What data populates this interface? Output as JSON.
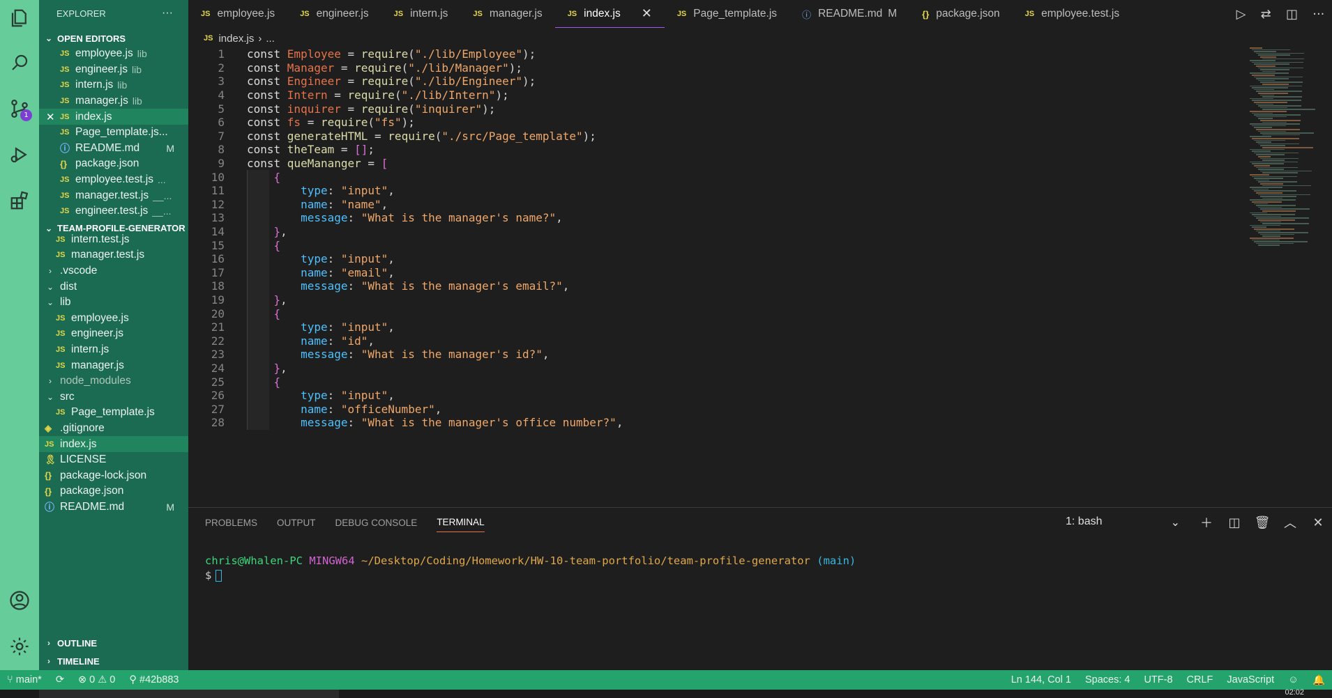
{
  "explorer": {
    "title": "EXPLORER",
    "more": "···",
    "open_editors_label": "OPEN EDITORS",
    "open_editors": [
      {
        "icon": "JS",
        "name": "employee.js",
        "desc": "lib",
        "mark": "",
        "close": ""
      },
      {
        "icon": "JS",
        "name": "engineer.js",
        "desc": "lib",
        "mark": "",
        "close": ""
      },
      {
        "icon": "JS",
        "name": "intern.js",
        "desc": "lib",
        "mark": "",
        "close": ""
      },
      {
        "icon": "JS",
        "name": "manager.js",
        "desc": "lib",
        "mark": "",
        "close": ""
      },
      {
        "icon": "JS",
        "name": "index.js",
        "desc": "",
        "mark": "",
        "close": "✕"
      },
      {
        "icon": "JS",
        "name": "Page_template.js...",
        "desc": "",
        "mark": "",
        "close": ""
      },
      {
        "icon": "ⓘ",
        "name": "README.md",
        "desc": "",
        "mark": "M",
        "close": ""
      },
      {
        "icon": "{}",
        "name": "package.json",
        "desc": "",
        "mark": "",
        "close": ""
      },
      {
        "icon": "JS",
        "name": "employee.test.js",
        "desc": "...",
        "mark": "",
        "close": ""
      },
      {
        "icon": "JS",
        "name": "manager.test.js",
        "desc": "__...",
        "mark": "",
        "close": ""
      },
      {
        "icon": "JS",
        "name": "engineer.test.js",
        "desc": "__...",
        "mark": "",
        "close": ""
      }
    ],
    "project_label": "TEAM-PROFILE-GENERATOR",
    "tree": [
      {
        "type": "file",
        "icon": "JS",
        "name": "intern.test.js",
        "indent": 1
      },
      {
        "type": "file",
        "icon": "JS",
        "name": "manager.test.js",
        "indent": 1
      },
      {
        "type": "folder",
        "twisty": "›",
        "name": ".vscode",
        "indent": 0
      },
      {
        "type": "folder",
        "twisty": "⌄",
        "name": "dist",
        "indent": 0
      },
      {
        "type": "folder",
        "twisty": "⌄",
        "name": "lib",
        "indent": 0
      },
      {
        "type": "file",
        "icon": "JS",
        "name": "employee.js",
        "indent": 1
      },
      {
        "type": "file",
        "icon": "JS",
        "name": "engineer.js",
        "indent": 1
      },
      {
        "type": "file",
        "icon": "JS",
        "name": "intern.js",
        "indent": 1
      },
      {
        "type": "file",
        "icon": "JS",
        "name": "manager.js",
        "indent": 1
      },
      {
        "type": "folder",
        "twisty": "›",
        "name": "node_modules",
        "indent": 0,
        "dim": true
      },
      {
        "type": "folder",
        "twisty": "⌄",
        "name": "src",
        "indent": 0
      },
      {
        "type": "file",
        "icon": "JS",
        "name": "Page_template.js",
        "indent": 1
      },
      {
        "type": "file",
        "icon": "◈",
        "name": ".gitignore",
        "indent": 0
      },
      {
        "type": "file",
        "icon": "JS",
        "name": "index.js",
        "indent": 0,
        "selected": true
      },
      {
        "type": "file",
        "icon": "🎗",
        "name": "LICENSE",
        "indent": 0
      },
      {
        "type": "file",
        "icon": "{}",
        "name": "package-lock.json",
        "indent": 0
      },
      {
        "type": "file",
        "icon": "{}",
        "name": "package.json",
        "indent": 0
      },
      {
        "type": "file",
        "icon": "ⓘ",
        "name": "README.md",
        "indent": 0,
        "mark": "M"
      }
    ],
    "outline_label": "OUTLINE",
    "timeline_label": "TIMELINE"
  },
  "activity": {
    "scm_badge": "1"
  },
  "tabs": [
    {
      "icon": "JS",
      "label": "employee.js",
      "active": false,
      "mod": ""
    },
    {
      "icon": "JS",
      "label": "engineer.js",
      "active": false,
      "mod": ""
    },
    {
      "icon": "JS",
      "label": "intern.js",
      "active": false,
      "mod": ""
    },
    {
      "icon": "JS",
      "label": "manager.js",
      "active": false,
      "mod": ""
    },
    {
      "icon": "JS",
      "label": "index.js",
      "active": true,
      "mod": ""
    },
    {
      "icon": "JS",
      "label": "Page_template.js",
      "active": false,
      "mod": ""
    },
    {
      "icon": "ⓘ",
      "label": "README.md",
      "active": false,
      "mod": "M"
    },
    {
      "icon": "{}",
      "label": "package.json",
      "active": false,
      "mod": ""
    },
    {
      "icon": "JS",
      "label": "employee.test.js",
      "active": false,
      "mod": ""
    }
  ],
  "breadcrumb": {
    "icon": "JS",
    "file": "index.js",
    "sep": "›",
    "rest": "..."
  },
  "code_lines": [
    [
      [
        "k",
        "const "
      ],
      [
        "v",
        "Employee"
      ],
      [
        "op",
        " = "
      ],
      [
        "f",
        "require"
      ],
      [
        "op",
        "("
      ],
      [
        "s",
        "\"./lib/Employee\""
      ],
      [
        "op",
        ");"
      ]
    ],
    [
      [
        "k",
        "const "
      ],
      [
        "v",
        "Manager"
      ],
      [
        "op",
        " = "
      ],
      [
        "f",
        "require"
      ],
      [
        "op",
        "("
      ],
      [
        "s",
        "\"./lib/Manager\""
      ],
      [
        "op",
        ");"
      ]
    ],
    [
      [
        "k",
        "const "
      ],
      [
        "v",
        "Engineer"
      ],
      [
        "op",
        " = "
      ],
      [
        "f",
        "require"
      ],
      [
        "op",
        "("
      ],
      [
        "s",
        "\"./lib/Engineer\""
      ],
      [
        "op",
        ");"
      ]
    ],
    [
      [
        "k",
        "const "
      ],
      [
        "v",
        "Intern"
      ],
      [
        "op",
        " = "
      ],
      [
        "f",
        "require"
      ],
      [
        "op",
        "("
      ],
      [
        "s",
        "\"./lib/Intern\""
      ],
      [
        "op",
        ");"
      ]
    ],
    [
      [
        "k",
        "const "
      ],
      [
        "v",
        "inquirer"
      ],
      [
        "op",
        " = "
      ],
      [
        "f",
        "require"
      ],
      [
        "op",
        "("
      ],
      [
        "s",
        "\"inquirer\""
      ],
      [
        "op",
        ");"
      ]
    ],
    [
      [
        "k",
        "const "
      ],
      [
        "v",
        "fs"
      ],
      [
        "op",
        " = "
      ],
      [
        "f",
        "require"
      ],
      [
        "op",
        "("
      ],
      [
        "s",
        "\"fs\""
      ],
      [
        "op",
        ");"
      ]
    ],
    [
      [
        "k",
        "const "
      ],
      [
        "f",
        "generateHTML"
      ],
      [
        "op",
        " = "
      ],
      [
        "f",
        "require"
      ],
      [
        "op",
        "("
      ],
      [
        "s",
        "\"./src/Page_template\""
      ],
      [
        "op",
        ");"
      ]
    ],
    [
      [
        "k",
        "const "
      ],
      [
        "f",
        "theTeam"
      ],
      [
        "op",
        " = "
      ],
      [
        "ob",
        "[]"
      ],
      [
        "op",
        ";"
      ]
    ],
    [
      [
        "k",
        "const "
      ],
      [
        "f",
        "queMananger"
      ],
      [
        "op",
        " = "
      ],
      [
        "ob",
        "["
      ]
    ],
    [
      [
        "op",
        "    "
      ],
      [
        "ob",
        "{"
      ]
    ],
    [
      [
        "op",
        "        "
      ],
      [
        "prop",
        "type"
      ],
      [
        "op",
        ": "
      ],
      [
        "s",
        "\"input\""
      ],
      [
        "op",
        ","
      ]
    ],
    [
      [
        "op",
        "        "
      ],
      [
        "prop",
        "name"
      ],
      [
        "op",
        ": "
      ],
      [
        "s",
        "\"name\""
      ],
      [
        "op",
        ","
      ]
    ],
    [
      [
        "op",
        "        "
      ],
      [
        "prop",
        "message"
      ],
      [
        "op",
        ": "
      ],
      [
        "s",
        "\"What is the manager's name?\""
      ],
      [
        "op",
        ","
      ]
    ],
    [
      [
        "op",
        "    "
      ],
      [
        "ob",
        "}"
      ],
      [
        "op",
        ","
      ]
    ],
    [
      [
        "op",
        "    "
      ],
      [
        "ob",
        "{"
      ]
    ],
    [
      [
        "op",
        "        "
      ],
      [
        "prop",
        "type"
      ],
      [
        "op",
        ": "
      ],
      [
        "s",
        "\"input\""
      ],
      [
        "op",
        ","
      ]
    ],
    [
      [
        "op",
        "        "
      ],
      [
        "prop",
        "name"
      ],
      [
        "op",
        ": "
      ],
      [
        "s",
        "\"email\""
      ],
      [
        "op",
        ","
      ]
    ],
    [
      [
        "op",
        "        "
      ],
      [
        "prop",
        "message"
      ],
      [
        "op",
        ": "
      ],
      [
        "s",
        "\"What is the manager's email?\""
      ],
      [
        "op",
        ","
      ]
    ],
    [
      [
        "op",
        "    "
      ],
      [
        "ob",
        "}"
      ],
      [
        "op",
        ","
      ]
    ],
    [
      [
        "op",
        "    "
      ],
      [
        "ob",
        "{"
      ]
    ],
    [
      [
        "op",
        "        "
      ],
      [
        "prop",
        "type"
      ],
      [
        "op",
        ": "
      ],
      [
        "s",
        "\"input\""
      ],
      [
        "op",
        ","
      ]
    ],
    [
      [
        "op",
        "        "
      ],
      [
        "prop",
        "name"
      ],
      [
        "op",
        ": "
      ],
      [
        "s",
        "\"id\""
      ],
      [
        "op",
        ","
      ]
    ],
    [
      [
        "op",
        "        "
      ],
      [
        "prop",
        "message"
      ],
      [
        "op",
        ": "
      ],
      [
        "s",
        "\"What is the manager's id?\""
      ],
      [
        "op",
        ","
      ]
    ],
    [
      [
        "op",
        "    "
      ],
      [
        "ob",
        "}"
      ],
      [
        "op",
        ","
      ]
    ],
    [
      [
        "op",
        "    "
      ],
      [
        "ob",
        "{"
      ]
    ],
    [
      [
        "op",
        "        "
      ],
      [
        "prop",
        "type"
      ],
      [
        "op",
        ": "
      ],
      [
        "s",
        "\"input\""
      ],
      [
        "op",
        ","
      ]
    ],
    [
      [
        "op",
        "        "
      ],
      [
        "prop",
        "name"
      ],
      [
        "op",
        ": "
      ],
      [
        "s",
        "\"officeNumber\""
      ],
      [
        "op",
        ","
      ]
    ],
    [
      [
        "op",
        "        "
      ],
      [
        "prop",
        "message"
      ],
      [
        "op",
        ": "
      ],
      [
        "s",
        "\"What is the manager's office number?\""
      ],
      [
        "op",
        ","
      ]
    ]
  ],
  "panel": {
    "tabs": [
      "PROBLEMS",
      "OUTPUT",
      "DEBUG CONSOLE",
      "TERMINAL"
    ],
    "active_tab": "TERMINAL",
    "terminal_select": "1: bash",
    "prompt_user": "chris@Whalen-PC",
    "prompt_host": "MINGW64",
    "prompt_path": "~/Desktop/Coding/Homework/HW-10-team-portfolio/team-profile-generator",
    "prompt_branch": "(main)",
    "prompt_symbol": "$"
  },
  "status": {
    "branch": "main*",
    "errors": "0",
    "warnings": "0",
    "commit": "#42b883",
    "position": "Ln 144, Col 1",
    "spaces": "Spaces: 4",
    "encoding": "UTF-8",
    "eol": "CRLF",
    "language": "JavaScript"
  },
  "taskbar": {
    "clock": "02:02"
  },
  "colors": {
    "activity_bg": "#66cc99",
    "sidebar_bg": "#1b6b52",
    "status_bg": "#24a46c",
    "accent_tab": "#a855f7"
  }
}
